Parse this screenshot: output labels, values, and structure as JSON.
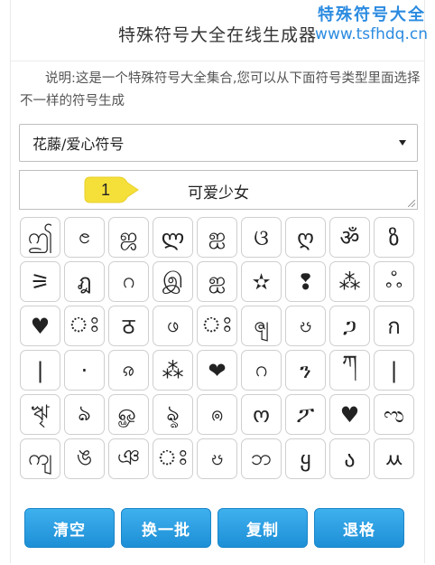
{
  "header": {
    "title": "特殊符号大全在线生成器",
    "watermark_line1": "特殊符号大全",
    "watermark_line2": "www.tsfhdq.cn"
  },
  "description": "说明:这是一个特殊符号大全集合,您可以从下面符号类型里面选择不一样的符号生成",
  "type_select": {
    "selected": "花藤/爱心符号"
  },
  "output": {
    "value": "可爱少女"
  },
  "callout": {
    "number": "1",
    "color": "#f5e03a"
  },
  "symbols": [
    "ဤ",
    "ၔ",
    "ஜ",
    "ლ",
    "ஐ",
    "ଓ",
    "ღ",
    "ॐ",
    "ზ",
    "⚞",
    "ฎ",
    "ဂ",
    "இ",
    "ஐ",
    "✫",
    "❢",
    "⁂",
    "ஃ",
    "♥",
    "ঃ",
    "ठ",
    "ဖ",
    "ঃ",
    "ၛ",
    "ၓ",
    "ጋ",
    "ก",
    "|",
    "·",
    "ၷ",
    "⁂",
    "❤",
    "ဂ",
    "ን",
    "ཀ",
    "|",
    "ৠ",
    "ঌ",
    "ௐ",
    "ৡ",
    "ၐ",
    "ო",
    "ፖ",
    "♥",
    "ಌ",
    "ကျ",
    "ঙ",
    "ঞ",
    "ঃ",
    "ၓ",
    "ဘ",
    "ყ",
    "ა",
    "ㅆ"
  ],
  "buttons": {
    "clear": "清空",
    "refresh": "换一批",
    "copy": "复制",
    "backspace": "退格"
  },
  "colors": {
    "button_blue": "#2b9fe3",
    "watermark_blue": "#2b8be0"
  }
}
